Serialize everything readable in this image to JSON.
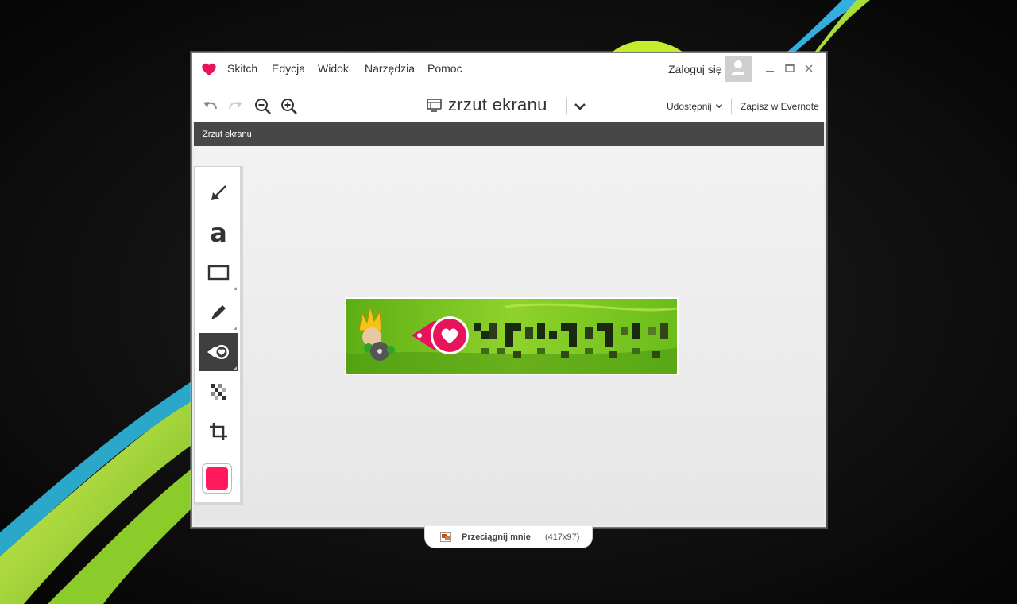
{
  "menu": {
    "items": [
      "Skitch",
      "Edycja",
      "Widok",
      "Narzędzia",
      "Pomoc"
    ],
    "login": "Zaloguj się"
  },
  "window_controls": {
    "minimize": "–",
    "maximize": "☐",
    "close": "×"
  },
  "toolbar": {
    "undo_icon": "undo-icon",
    "redo_icon": "redo-icon",
    "zoom_out_icon": "zoom-out-icon",
    "zoom_in_icon": "zoom-in-icon",
    "document_title": "zrzut ekranu",
    "share": "Udostępnij",
    "save_evernote": "Zapisz w Evernote"
  },
  "titlebar": {
    "label": "Zrzut ekranu"
  },
  "tools": [
    {
      "name": "arrow-tool",
      "icon": "arrow-icon",
      "active": false
    },
    {
      "name": "text-tool",
      "icon": "text-a-icon",
      "active": false
    },
    {
      "name": "rectangle-tool",
      "icon": "rectangle-icon",
      "active": false
    },
    {
      "name": "pen-tool",
      "icon": "pen-icon",
      "active": false
    },
    {
      "name": "stamp-tool",
      "icon": "stamp-icon",
      "active": true
    },
    {
      "name": "pixelate-tool",
      "icon": "pixelate-icon",
      "active": false
    },
    {
      "name": "crop-tool",
      "icon": "crop-icon",
      "active": false
    }
  ],
  "text_tool_glyph": "a",
  "current_color": "#ff1a5b",
  "drag_tab": {
    "label": "Przeciągnij mnie",
    "dimensions": "(417x97)"
  },
  "colors": {
    "accent": "#e8135a",
    "titlebar": "#474747"
  }
}
